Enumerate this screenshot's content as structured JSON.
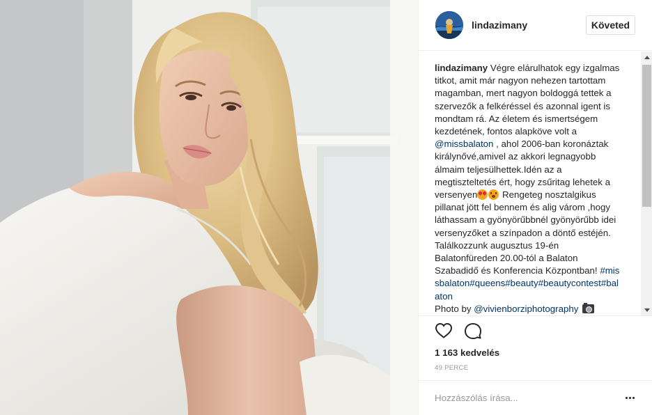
{
  "post": {
    "photo_description_icon": "photo-icon"
  },
  "header": {
    "username": "lindazimany",
    "follow_label": "Követed"
  },
  "caption": {
    "username": "lindazimany",
    "text_1": "Végre elárulhatok egy izgalmas titkot, amit már nagyon nehezen tartottam magamban, mert nagyon boldoggá tettek a szervezők a felkéréssel és azonnal igent is mondtam rá. Az életem és ismertségem kezdetének, fontos alapköve volt a ",
    "mention_1": "@missbalaton",
    "text_2": " , ahol 2006-ban koronáztak királynővé,amivel az akkori legnagyobb álmaim teljesülhettek.Idén az a megtiszteltetés ért, hogy zsűritag lehetek a versenyen",
    "text_3": " Rengeteg nosztalgikus pillanat jött fel bennem és alig várom ,hogy láthassam a gyönyörűbbnél gyönyörűbb idei versenyzőket a színpadon a döntő estéjén. Találkozzunk augusztus 19-én Balatonfüreden 20.00-tól a Balaton Szabadidő és Konferencia Központban!",
    "hashtags": "#missbalaton#queens#beauty#beautycontest#balaton",
    "photo_by": "Photo by ",
    "mention_2": "@vivienborziphotography",
    "emojis": [
      "heart-eyes-emoji",
      "shocked-emoji",
      "camera-emoji"
    ]
  },
  "actions": {
    "like_icon": "heart-icon",
    "comment_icon": "comment-icon"
  },
  "likes_text": "1 163 kedvelés",
  "timestamp": "49 PERCE",
  "comment": {
    "placeholder": "Hozzászólás írása...",
    "more_icon": "more-options-icon"
  },
  "colors": {
    "link": "#003569",
    "text": "#262626",
    "muted": "#999999",
    "border": "#efefef"
  }
}
